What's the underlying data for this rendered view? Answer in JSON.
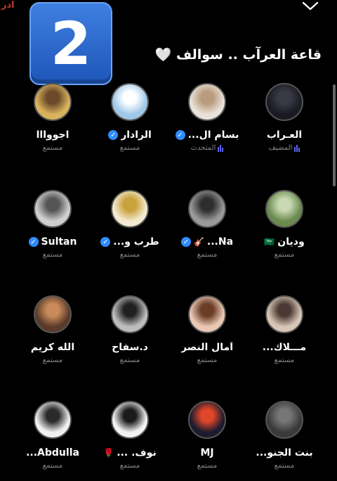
{
  "corner_text": "ادر",
  "sticker_text": "2",
  "room_title": "قاعة العرآب .. سوالف 🤍",
  "participants": [
    {
      "name": "العـراب",
      "role": "المضيف",
      "verified": false,
      "extra": "",
      "speaking": true,
      "avatar": "avatar-group",
      "colors": [
        "#1a1a22",
        "#3a3a46"
      ]
    },
    {
      "name": "بسام ال...",
      "role": "المتحدث",
      "verified": true,
      "extra": "",
      "speaking": true,
      "avatar": "avatar-man-shemagh",
      "colors": [
        "#e8e2d8",
        "#b99c7e"
      ]
    },
    {
      "name": "الرادار",
      "role": "مستمع",
      "verified": true,
      "extra": "",
      "speaking": false,
      "avatar": "avatar-radar-dish",
      "colors": [
        "#9fc8e8",
        "#ffffff"
      ]
    },
    {
      "name": "اجووااا",
      "role": "مستمع",
      "verified": false,
      "extra": "",
      "speaking": false,
      "avatar": "avatar-cartoon",
      "colors": [
        "#d9b35c",
        "#6b4a2a"
      ]
    },
    {
      "name": "وديان",
      "role": "مستمع",
      "verified": false,
      "extra": "🇸🇦",
      "speaking": false,
      "avatar": "avatar-green-scene",
      "colors": [
        "#6a8a4f",
        "#c8d8b0"
      ]
    },
    {
      "name": "Na...",
      "role": "مستمع",
      "verified": true,
      "extra": "🎸",
      "speaking": false,
      "avatar": "avatar-bw-photo",
      "colors": [
        "#9a9a9a",
        "#2e2e2e"
      ]
    },
    {
      "name": "طرب و...",
      "role": "مستمع",
      "verified": true,
      "extra": "",
      "speaking": false,
      "avatar": "avatar-gold-clef",
      "colors": [
        "#f4ead2",
        "#c9a23c"
      ]
    },
    {
      "name": "Sultan",
      "role": "مستمع",
      "verified": true,
      "extra": "",
      "speaking": false,
      "avatar": "avatar-rocks",
      "colors": [
        "#cfcfcf",
        "#555555"
      ]
    },
    {
      "name": "مـــلاك...",
      "role": "مستمع",
      "verified": false,
      "extra": "",
      "speaking": false,
      "avatar": "avatar-short-hair-woman",
      "colors": [
        "#d8c7b7",
        "#4a3a33"
      ]
    },
    {
      "name": "آمال النصر",
      "role": "مستمع",
      "verified": false,
      "extra": "",
      "speaking": false,
      "avatar": "avatar-woman",
      "colors": [
        "#e9c9b5",
        "#6b3c26"
      ]
    },
    {
      "name": "د.سفاح",
      "role": "مستمع",
      "verified": false,
      "extra": "",
      "speaking": false,
      "avatar": "avatar-man-bw",
      "colors": [
        "#bdbdbd",
        "#202020"
      ]
    },
    {
      "name": "الله كريم",
      "role": "مستمع",
      "verified": false,
      "extra": "",
      "speaking": false,
      "avatar": "avatar-corridor",
      "colors": [
        "#5a3b2b",
        "#c98b5a"
      ]
    },
    {
      "name": "بنت الجنو...",
      "role": "مستمع",
      "verified": false,
      "extra": "",
      "speaking": false,
      "avatar": "avatar-dark-text",
      "colors": [
        "#3a3a3a",
        "#777777"
      ]
    },
    {
      "name": "MJ",
      "role": "مستمع",
      "verified": false,
      "extra": "",
      "speaking": false,
      "avatar": "avatar-night-sky",
      "colors": [
        "#1b1b2e",
        "#e0462a"
      ]
    },
    {
      "name": "نوف. ...",
      "role": "مستمع",
      "verified": false,
      "extra": "🌹",
      "speaking": false,
      "avatar": "avatar-woman-hair",
      "colors": [
        "#f2f2f2",
        "#1a1a1a"
      ]
    },
    {
      "name": "Abdulla...",
      "role": "مستمع",
      "verified": false,
      "extra": "",
      "speaking": false,
      "avatar": "avatar-sketch-man",
      "colors": [
        "#f0f0f0",
        "#2a2a2a"
      ]
    }
  ]
}
